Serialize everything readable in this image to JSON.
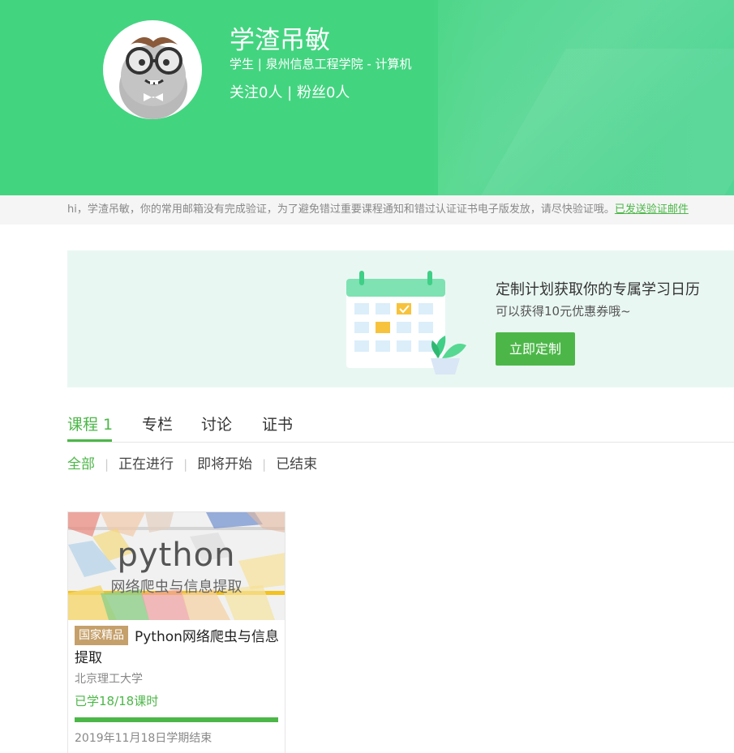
{
  "profile": {
    "name": "学渣吊敏",
    "subtitle": "学生 | 泉州信息工程学院 - 计算机",
    "follow": "关注0人 | 粉丝0人"
  },
  "notice": {
    "text": "hi，学渣吊敏，你的常用邮箱没有完成验证，为了避免错过重要课程通知和错过认证证书电子版发放，请尽快验证哦。",
    "link": "已发送验证邮件"
  },
  "promo": {
    "title": "定制计划获取你的专属学习日历",
    "subtitle": "可以获得10元优惠券哦~",
    "button": "立即定制"
  },
  "tabs": [
    {
      "label": "课程 1"
    },
    {
      "label": "专栏"
    },
    {
      "label": "讨论"
    },
    {
      "label": "证书"
    }
  ],
  "filters": [
    {
      "label": "全部"
    },
    {
      "label": "正在进行"
    },
    {
      "label": "即将开始"
    },
    {
      "label": "已结束"
    }
  ],
  "course": {
    "cover_title": "python",
    "cover_subtitle": "网络爬虫与信息提取",
    "badge": "国家精品",
    "name": "Python网络爬虫与信息提取",
    "school": "北京理工大学",
    "progress_text": "已学18/18课时",
    "progress_fraction": 1.0,
    "end_date": "2019年11月18日学期结束"
  },
  "colors": {
    "banner": "#43d480",
    "accent": "#4cb748",
    "badge": "#c5a06b",
    "promo_bg": "#e9f7f3"
  }
}
